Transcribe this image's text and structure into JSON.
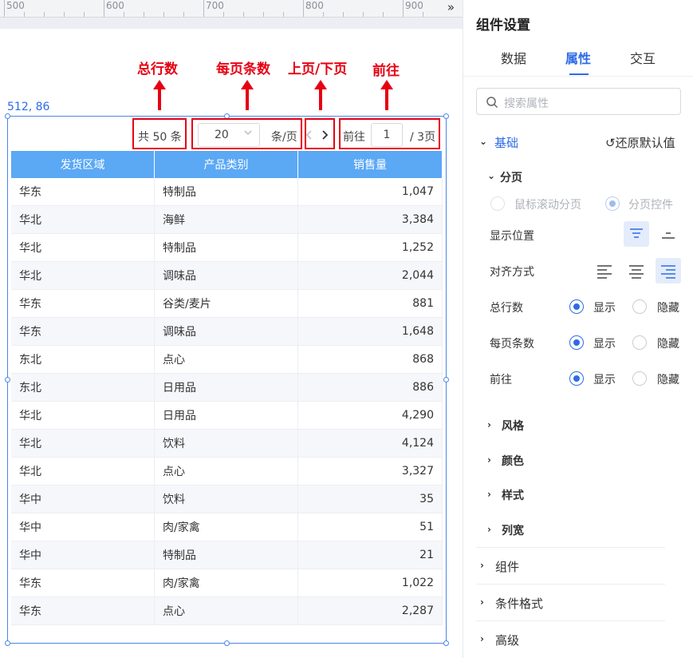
{
  "ruler": {
    "labels": [
      "500",
      "600",
      "700",
      "800",
      "900"
    ],
    "expand_icon": "double-chevron-right"
  },
  "canvas": {
    "coordinate": "512, 86"
  },
  "annotations": {
    "total_rows": "总行数",
    "per_page": "每页条数",
    "prev_next": "上页/下页",
    "goto": "前往"
  },
  "pagination": {
    "total": "共 50 条",
    "page_size": "20",
    "per_page_suffix": "条/页",
    "goto_label": "前往",
    "goto_value": "1",
    "pages": "/ 3页"
  },
  "table": {
    "columns": [
      "发货区域",
      "产品类别",
      "销售量"
    ],
    "rows": [
      [
        "华东",
        "特制品",
        "1,047"
      ],
      [
        "华北",
        "海鲜",
        "3,384"
      ],
      [
        "华北",
        "特制品",
        "1,252"
      ],
      [
        "华北",
        "调味品",
        "2,044"
      ],
      [
        "华东",
        "谷类/麦片",
        "881"
      ],
      [
        "华东",
        "调味品",
        "1,648"
      ],
      [
        "东北",
        "点心",
        "868"
      ],
      [
        "东北",
        "日用品",
        "886"
      ],
      [
        "华北",
        "日用品",
        "4,290"
      ],
      [
        "华北",
        "饮料",
        "4,124"
      ],
      [
        "华北",
        "点心",
        "3,327"
      ],
      [
        "华中",
        "饮料",
        "35"
      ],
      [
        "华中",
        "肉/家禽",
        "51"
      ],
      [
        "华中",
        "特制品",
        "21"
      ],
      [
        "华东",
        "肉/家禽",
        "1,022"
      ],
      [
        "华东",
        "点心",
        "2,287"
      ]
    ]
  },
  "panel": {
    "title": "组件设置",
    "tabs": [
      "数据",
      "属性",
      "交互"
    ],
    "active_tab": "属性",
    "search_placeholder": "搜索属性",
    "basic": "基础",
    "reset": "还原默认值",
    "paging": "分页",
    "paging_mode": {
      "scroll": "鼠标滚动分页",
      "control": "分页控件"
    },
    "position_label": "显示位置",
    "align_label": "对齐方式",
    "total_rows_label": "总行数",
    "per_page_label": "每页条数",
    "goto_label": "前往",
    "show": "显示",
    "hide": "隐藏",
    "subsections": [
      "风格",
      "颜色",
      "样式",
      "列宽"
    ],
    "sections": [
      "组件",
      "条件格式",
      "高级"
    ],
    "accent": "#2e6be6"
  }
}
